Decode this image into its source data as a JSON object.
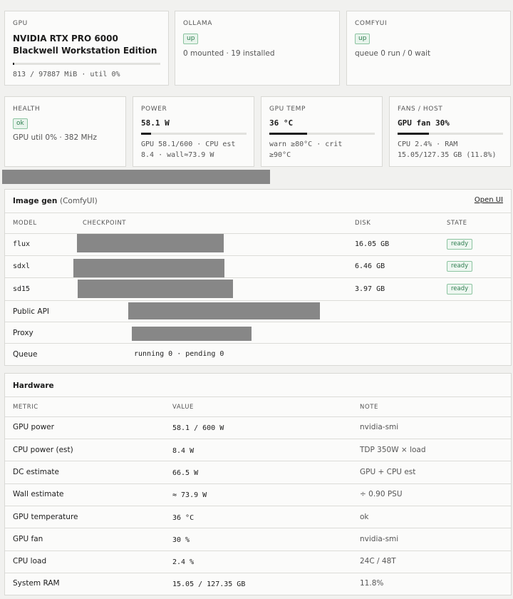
{
  "cards": {
    "gpu": {
      "label": "GPU",
      "name": "NVIDIA RTX PRO 6000 Blackwell Workstation Edition",
      "mem_fraction": 0.0083,
      "sub": "813 / 97887 MiB · util 0%"
    },
    "ollama": {
      "label": "OLLAMA",
      "badge": "up",
      "sub": "0 mounted · 19 installed"
    },
    "comfyui": {
      "label": "COMFYUI",
      "badge": "up",
      "sub": "queue 0 run / 0 wait"
    },
    "health": {
      "label": "HEALTH",
      "badge": "ok",
      "sub": "GPU util 0% · 382 MHz"
    },
    "power": {
      "label": "POWER",
      "value": "58.1 W",
      "fraction": 0.097,
      "sub1": "GPU 58.1/600 · CPU est",
      "sub2": "8.4 · wall≈73.9 W"
    },
    "gpu_temp": {
      "label": "GPU TEMP",
      "value": "36 °C",
      "fraction": 0.36,
      "sub1": "warn ≥80°C · crit",
      "sub2": "≥90°C"
    },
    "fans": {
      "label": "FANS / HOST",
      "value": "GPU fan 30%",
      "fraction": 0.3,
      "sub1": "CPU 2.4% · RAM",
      "sub2": "15.05/127.35 GB (11.8%)"
    }
  },
  "image_gen": {
    "title": "Image gen",
    "subtitle": "(ComfyUI)",
    "link": "Open UI",
    "headers": [
      "MODEL",
      "CHECKPOINT",
      "DISK",
      "STATE"
    ],
    "models": [
      {
        "name": "flux",
        "disk": "16.05 GB",
        "state": "ready"
      },
      {
        "name": "sdxl",
        "disk": "6.46 GB",
        "state": "ready"
      },
      {
        "name": "sd15",
        "disk": "3.97 GB",
        "state": "ready"
      }
    ],
    "public_api_label": "Public API",
    "proxy_label": "Proxy",
    "queue_label": "Queue",
    "queue_value": "running 0 · pending 0"
  },
  "hardware": {
    "title": "Hardware",
    "headers": [
      "METRIC",
      "VALUE",
      "NOTE"
    ],
    "rows": [
      {
        "metric": "GPU power",
        "value": "58.1 / 600 W",
        "note": "nvidia-smi"
      },
      {
        "metric": "CPU power (est)",
        "value": "8.4 W",
        "note": "TDP 350W × load"
      },
      {
        "metric": "DC estimate",
        "value": "66.5 W",
        "note": "GPU + CPU est"
      },
      {
        "metric": "Wall estimate",
        "value": "≈ 73.9 W",
        "note": "÷ 0.90 PSU"
      },
      {
        "metric": "GPU temperature",
        "value": "36 °C",
        "note": "ok"
      },
      {
        "metric": "GPU fan",
        "value": "30 %",
        "note": "nvidia-smi"
      },
      {
        "metric": "CPU load",
        "value": "2.4 %",
        "note": "24C / 48T"
      },
      {
        "metric": "System RAM",
        "value": "15.05 / 127.35 GB",
        "note": "11.8%"
      }
    ]
  }
}
